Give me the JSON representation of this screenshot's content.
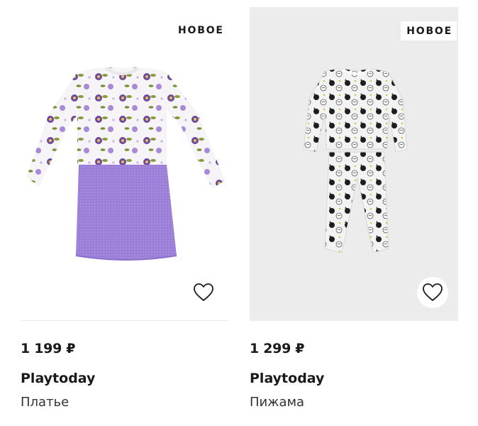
{
  "products": [
    {
      "badge": "НОВОЕ",
      "image_icon": "dress-image",
      "favorite_icon": "heart-outline-icon",
      "price": "1 199 ₽",
      "brand": "Playtoday",
      "name": "Платье"
    },
    {
      "badge": "НОВОЕ",
      "image_icon": "pajamas-image",
      "favorite_icon": "heart-outline-icon",
      "price": "1 299 ₽",
      "brand": "Playtoday",
      "name": "Пижама"
    }
  ],
  "colors": {
    "accent_purple": "#9b7fd9",
    "tile_gray": "#ececec",
    "text": "#1a1a1a"
  }
}
